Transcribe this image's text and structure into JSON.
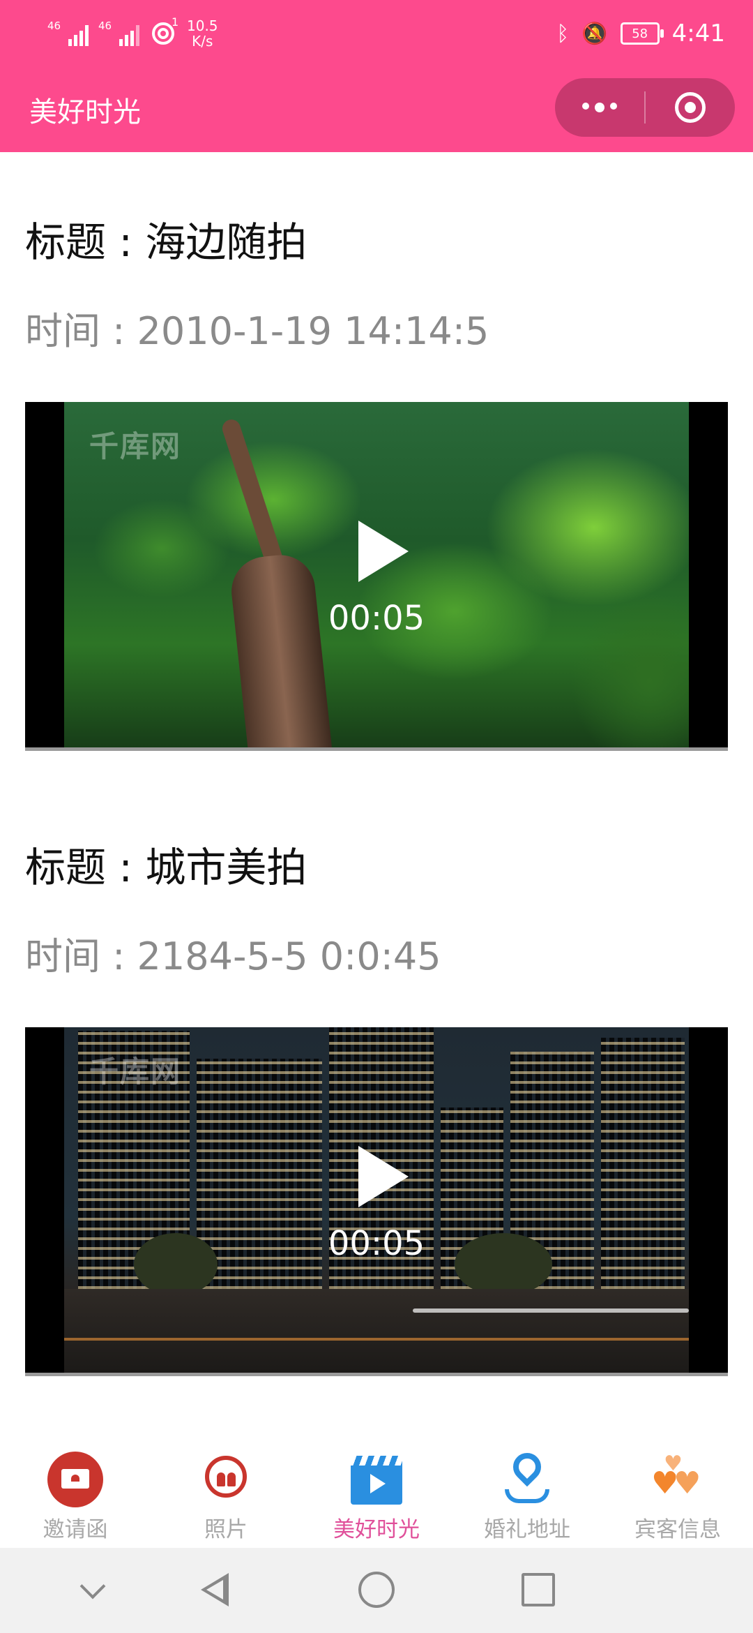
{
  "status_bar": {
    "network_1": "46",
    "network_2": "46",
    "hotspot_badge": "1",
    "speed_value": "10.5",
    "speed_unit": "K/s",
    "battery": "58",
    "time": "4:41"
  },
  "nav": {
    "title": "美好时光"
  },
  "items": [
    {
      "title": "标题 : 海边随拍",
      "time": "时间 : 2010-1-19 14:14:5",
      "duration": "00:05",
      "watermark": "千库网"
    },
    {
      "title": "标题 : 城市美拍",
      "time": "时间 : 2184-5-5 0:0:45",
      "duration": "00:05",
      "watermark": "千库网"
    }
  ],
  "tabs": [
    {
      "label": "邀请函",
      "icon": "invitation-icon"
    },
    {
      "label": "照片",
      "icon": "photo-icon"
    },
    {
      "label": "美好时光",
      "icon": "video-icon",
      "active": true
    },
    {
      "label": "婚礼地址",
      "icon": "location-pin-icon"
    },
    {
      "label": "宾客信息",
      "icon": "hearts-icon"
    }
  ],
  "colors": {
    "brand": "#fd4a8d",
    "active_tab": "#e0509a",
    "inactive_tab": "#a8a8a8"
  }
}
